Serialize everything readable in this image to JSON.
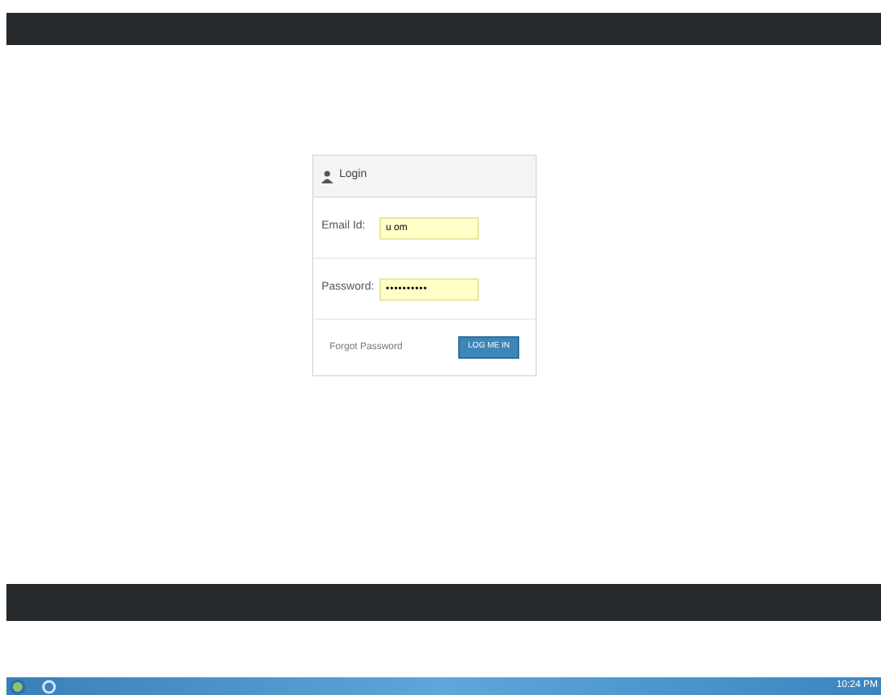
{
  "login": {
    "title": "Login",
    "fields": [
      {
        "label": "Email Id:",
        "value": "u om",
        "kind": "email"
      },
      {
        "label": "Password:",
        "value": "••••••••••",
        "kind": "password"
      }
    ],
    "forgot_link": "Forgot Password",
    "submit": "LOG ME IN"
  },
  "taskbar": {
    "clock": "10:24 PM"
  }
}
